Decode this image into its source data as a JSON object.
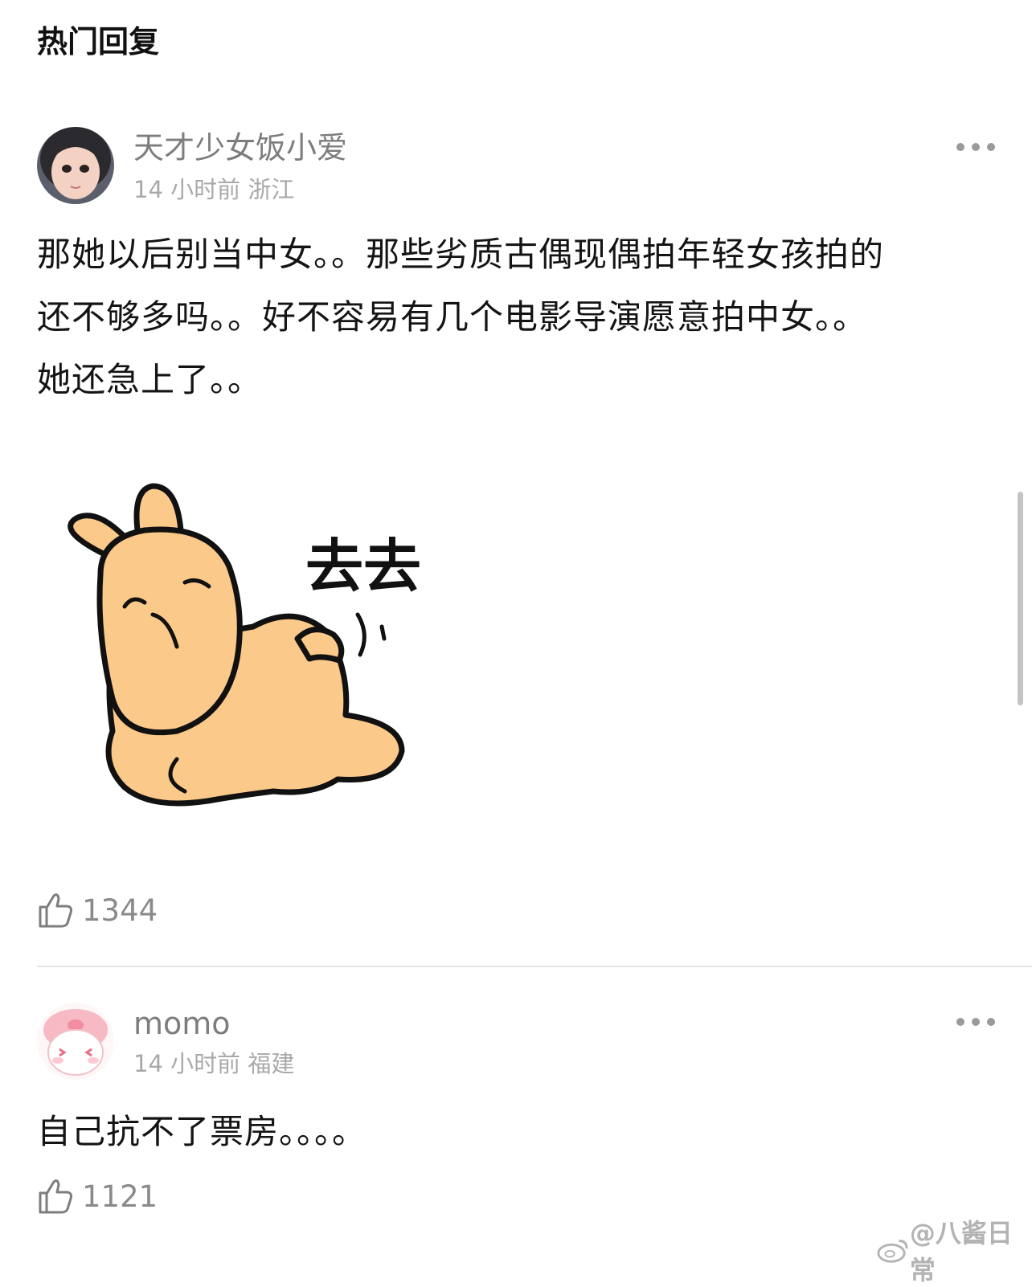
{
  "section_title": "热门回复",
  "comments": [
    {
      "username": "天才少女饭小爱",
      "time": "14 小时前",
      "location": "浙江",
      "text_lines": [
        "那她以后别当中女。。那些劣质古偶现偶拍年轻女孩拍的",
        "还不够多吗。。好不容易有几个电影导演愿意拍中女。。",
        "她还急上了。。"
      ],
      "sticker": {
        "caption": "去去",
        "icon": "lying-dog-sticker"
      },
      "likes": "1344"
    },
    {
      "username": "momo",
      "time": "14 小时前",
      "location": "福建",
      "text_lines": [
        "自己抗不了票房。。。。"
      ],
      "likes": "1121"
    }
  ],
  "watermark": "@八酱日常",
  "colors": {
    "username": "#7d7d7d",
    "meta": "#a9a9a9",
    "body": "#141414",
    "sticker_fill": "#fbc98a",
    "sticker_stroke": "#111111"
  },
  "icons": [
    "avatar-girl",
    "avatar-pig-hat",
    "more-dots-icon",
    "thumbs-up-icon",
    "weibo-logo-icon"
  ]
}
